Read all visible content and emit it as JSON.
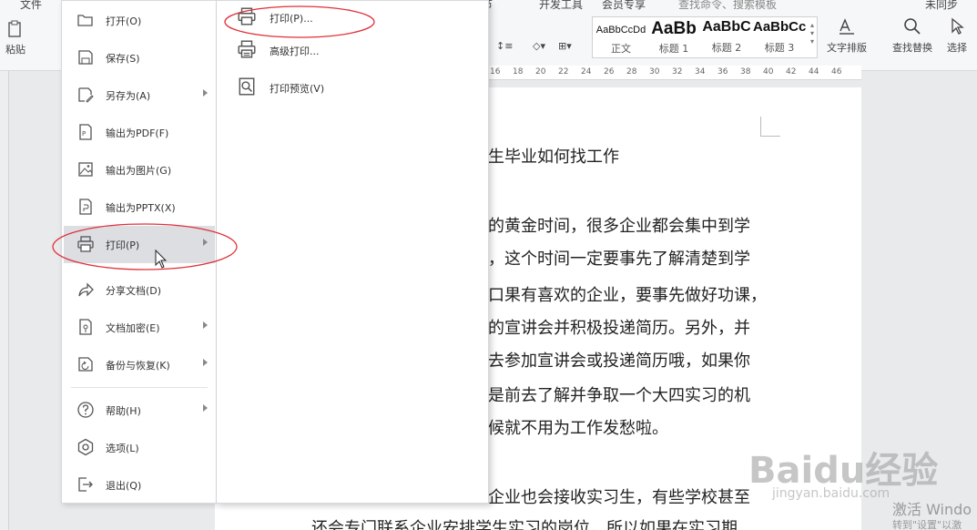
{
  "ribbon": {
    "tabs": [
      "文件",
      "章节",
      "开发工具",
      "会员专享"
    ],
    "search_hint": "查找命令、搜索模板",
    "user_hint": "未同步",
    "paste_label": "粘贴",
    "styles": [
      {
        "sample": "AaBbCcDd",
        "name": "正文"
      },
      {
        "sample": "AaBb",
        "name": "标题 1"
      },
      {
        "sample": "AaBbC",
        "name": "标题 2"
      },
      {
        "sample": "AaBbCc",
        "name": "标题 3"
      }
    ],
    "text_layout_label": "文字排版",
    "find_replace_label": "查找替换",
    "select_label": "选择"
  },
  "ruler": {
    "ticks": [
      "16",
      "18",
      "20",
      "22",
      "24",
      "26",
      "28",
      "30",
      "32",
      "34",
      "36",
      "38",
      "40",
      "42",
      "44",
      "46"
    ]
  },
  "file_menu": {
    "items": [
      {
        "label": "打开(O)",
        "icon": "folder-open-icon"
      },
      {
        "label": "保存(S)",
        "icon": "save-icon"
      },
      {
        "label": "另存为(A)",
        "icon": "save-as-icon"
      },
      {
        "label": "输出为PDF(F)",
        "icon": "pdf-icon"
      },
      {
        "label": "输出为图片(G)",
        "icon": "image-icon"
      },
      {
        "label": "输出为PPTX(X)",
        "icon": "pptx-icon"
      },
      {
        "label": "打印(P)",
        "icon": "printer-icon"
      },
      {
        "label": "分享文档(D)",
        "icon": "share-icon"
      },
      {
        "label": "文档加密(E)",
        "icon": "lock-doc-icon"
      },
      {
        "label": "备份与恢复(K)",
        "icon": "backup-icon"
      },
      {
        "label": "帮助(H)",
        "icon": "help-icon"
      },
      {
        "label": "选项(L)",
        "icon": "gear-icon"
      },
      {
        "label": "退出(Q)",
        "icon": "exit-icon"
      }
    ],
    "submenu": [
      {
        "label": "打印(P)...",
        "icon": "printer-icon"
      },
      {
        "label": "高级打印...",
        "icon": "advanced-print-icon"
      },
      {
        "label": "打印预览(V)",
        "icon": "print-preview-icon"
      }
    ]
  },
  "document": {
    "lines": [
      "生毕业如何找工作",
      "的黄金时间，很多企业都会集中到学",
      "，这个时间一定要事先了解清楚到学",
      "口果有喜欢的企业，要事先做好功课，",
      "的宣讲会并积极投递简历。另外，并",
      "去参加宣讲会或投递简历哦，如果你",
      "是前去了解并争取一个大四实习的机",
      "候就不用为工作发愁啦。",
      "企业也会接收实习生，有些学校甚至",
      "还会专门联系企业安排学生实习的岗位，所以如果在实习期"
    ]
  },
  "watermark": {
    "brand": "Baidu经验",
    "url": "jingyan.baidu.com",
    "activate": "激活 Windo",
    "activate_sub": "转到\"设置\"以激"
  },
  "colors": {
    "annotation": "#e0303a",
    "menu_active": "#dcdee2",
    "ribbon_bg": "#f6f7f8"
  }
}
